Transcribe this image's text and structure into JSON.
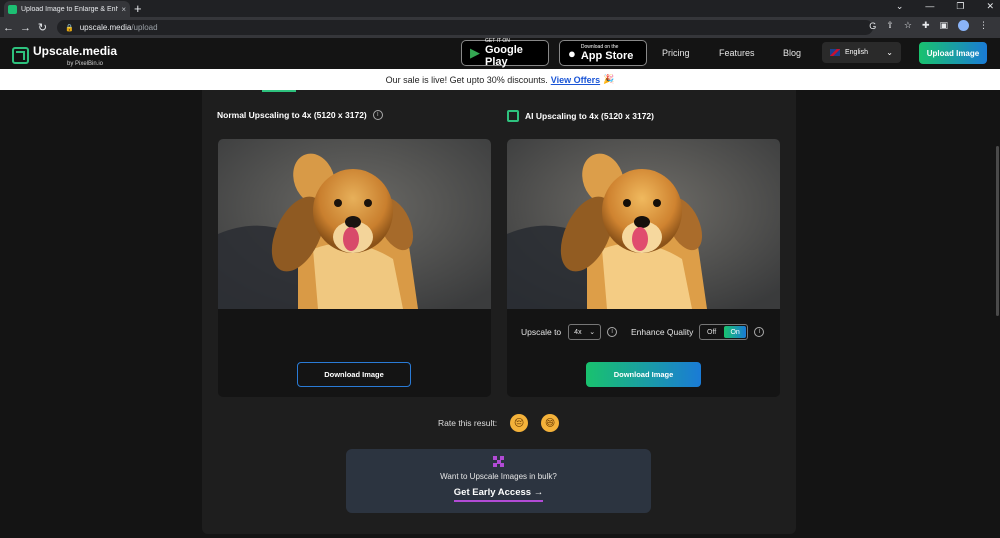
{
  "browser": {
    "tab_title": "Upload Image to Enlarge & Enha",
    "tab_close": "×",
    "new_tab": "+",
    "url_host": "upscale.media",
    "url_path": "/upload",
    "win_min": "⌄",
    "win_minimize": "—",
    "win_restore": "❐",
    "win_close": "✕"
  },
  "header": {
    "logo_name": "Upscale.media",
    "logo_by": "by PixelBin.io",
    "google_small": "GET IT ON",
    "google_big": "Google Play",
    "apple_small": "Download on the",
    "apple_big": "App Store",
    "nav": [
      "Pricing",
      "Features",
      "Blog"
    ],
    "language": "English",
    "upload_button": "Upload Image"
  },
  "banner": {
    "text": "Our sale is live! Get upto 30% discounts.",
    "offer": "View Offers",
    "party": "🎉"
  },
  "left": {
    "title": "Normal Upscaling to 4x (5120 x 3172)",
    "download": "Download Image"
  },
  "right": {
    "title": "AI Upscaling to 4x (5120 x 3172)",
    "upscale_label": "Upscale to",
    "upscale_value": "4x",
    "enhance_label": "Enhance Quality",
    "toggle_off": "Off",
    "toggle_on": "On",
    "download": "Download Image"
  },
  "rating": {
    "label": "Rate this result:",
    "bad": "😔",
    "good": "😄"
  },
  "bulk": {
    "question": "Want to Upscale Images in bulk?",
    "cta": "Get Early Access →"
  },
  "colors": {
    "accent_green": "#19c26e",
    "accent_blue": "#1a7bd6",
    "purple": "#b24bd6"
  }
}
